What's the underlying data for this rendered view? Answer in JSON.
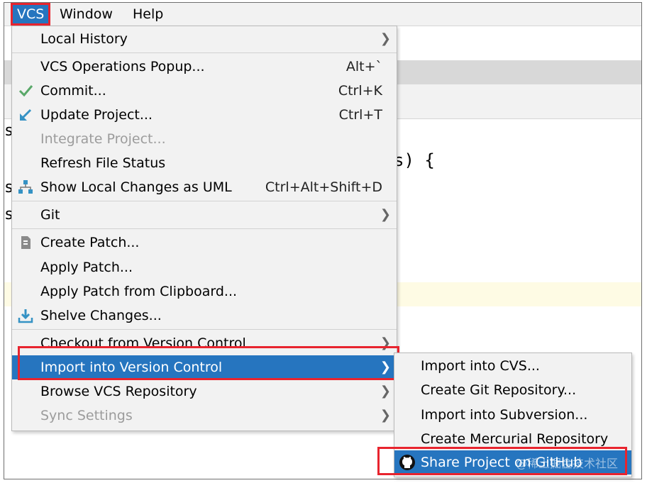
{
  "menubar": {
    "items": [
      {
        "label": "VCS",
        "mnemonic": "S"
      },
      {
        "label": "Window",
        "mnemonic": "W"
      },
      {
        "label": "Help",
        "mnemonic": "H"
      }
    ]
  },
  "background": {
    "code_fragment": "s) {",
    "gutter_letters": [
      "s",
      "s",
      "s"
    ]
  },
  "vcs_menu": {
    "items": [
      {
        "label": "Local History",
        "submenu": true
      },
      {
        "label": "VCS Operations Popup...",
        "shortcut": "Alt+`"
      },
      {
        "label": "Commit...",
        "shortcut": "Ctrl+K",
        "icon": "check-icon"
      },
      {
        "label": "Update Project...",
        "shortcut": "Ctrl+T",
        "icon": "update-arrow-icon"
      },
      {
        "label": "Integrate Project...",
        "disabled": true
      },
      {
        "label": "Refresh File Status"
      },
      {
        "label": "Show Local Changes as UML",
        "shortcut": "Ctrl+Alt+Shift+D",
        "icon": "uml-diagram-icon"
      },
      {
        "label": "Git",
        "submenu": true
      },
      {
        "label": "Create Patch...",
        "icon": "patch-file-icon"
      },
      {
        "label": "Apply Patch..."
      },
      {
        "label": "Apply Patch from Clipboard..."
      },
      {
        "label": "Shelve Changes...",
        "icon": "shelve-icon"
      },
      {
        "label": "Checkout from Version Control",
        "submenu": true
      },
      {
        "label": "Import into Version Control",
        "submenu": true,
        "active": true
      },
      {
        "label": "Browse VCS Repository",
        "submenu": true
      },
      {
        "label": "Sync Settings",
        "submenu": true,
        "disabled": true
      }
    ]
  },
  "import_submenu": {
    "items": [
      {
        "label": "Import into CVS..."
      },
      {
        "label": "Create Git Repository..."
      },
      {
        "label": "Import into Subversion..."
      },
      {
        "label": "Create Mercurial Repository"
      },
      {
        "label": "Share Project on GitHub",
        "icon": "github-icon",
        "active": true
      }
    ]
  },
  "watermark": "@稀土掘金技术社区",
  "colors": {
    "highlight": "#2675bf",
    "annotation_box": "#e8242e",
    "check": "#59a869",
    "update": "#3592c4"
  }
}
